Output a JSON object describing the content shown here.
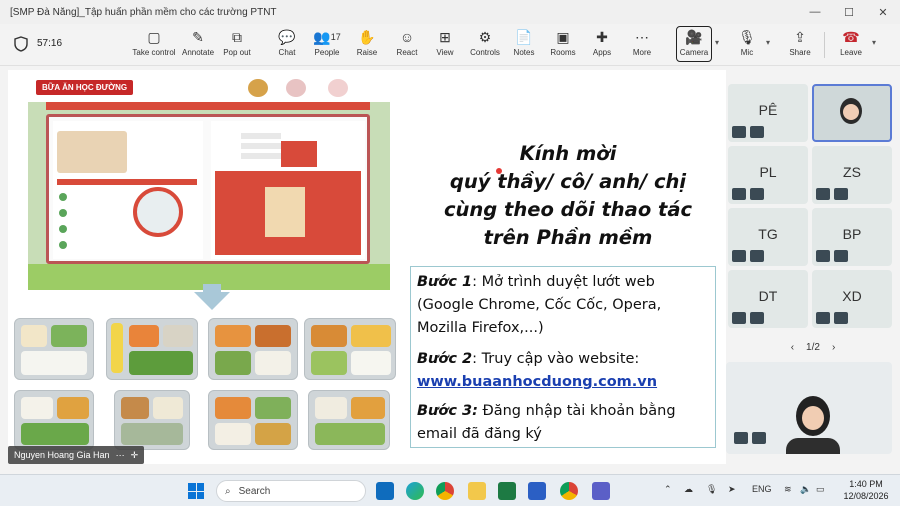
{
  "window": {
    "title": "[SMP Đà Nẵng]_Tập huấn phần mềm cho các trường PTNT",
    "min": "—",
    "max": "☐",
    "close": "✕"
  },
  "toolbar": {
    "timer": "57:16",
    "buttons": [
      {
        "id": "take-control",
        "label": "Take control",
        "icon": "▢"
      },
      {
        "id": "annotate",
        "label": "Annotate",
        "icon": "✎"
      },
      {
        "id": "pop-out",
        "label": "Pop out",
        "icon": "⧉"
      },
      {
        "id": "chat",
        "label": "Chat",
        "icon": "💬"
      },
      {
        "id": "people",
        "label": "People",
        "icon": "👥",
        "count": "17"
      },
      {
        "id": "raise",
        "label": "Raise",
        "icon": "✋"
      },
      {
        "id": "react",
        "label": "React",
        "icon": "☺"
      },
      {
        "id": "view",
        "label": "View",
        "icon": "⊞"
      },
      {
        "id": "controls",
        "label": "Controls",
        "icon": "⚙"
      },
      {
        "id": "notes",
        "label": "Notes",
        "icon": "📄"
      },
      {
        "id": "rooms",
        "label": "Rooms",
        "icon": "▣"
      },
      {
        "id": "apps",
        "label": "Apps",
        "icon": "✚"
      },
      {
        "id": "more",
        "label": "More",
        "icon": "⋯"
      }
    ],
    "camera": {
      "label": "Camera",
      "icon": "🎥"
    },
    "mic": {
      "label": "Mic",
      "icon": "🎙"
    },
    "share": {
      "label": "Share",
      "icon": "⇪"
    },
    "leave": {
      "label": "Leave",
      "icon": "☎"
    }
  },
  "slide": {
    "website_logo": "BỮA ĂN HỌC ĐƯỜNG",
    "invite_lines": [
      "Kính mời",
      "quý thầy/ cô/ anh/ chị",
      "cùng theo dõi thao tác",
      "trên Phần mềm"
    ],
    "step1_label": "Bước 1",
    "step1_text": ": Mở trình duyệt lướt web (Google Chrome, Cốc Cốc, Opera, Mozilla Firefox,...)",
    "step2_label": "Bước 2",
    "step2_text": ": Truy cập vào website:",
    "step2_link": "www.buaanhocduong.com.vn",
    "step3_label": "Bước 3:",
    "step3_text": " Đăng nhập tài khoản bằng email đã đăng ký"
  },
  "presenter": {
    "name": "Nguyen Hoang Gia Han",
    "more": "⋯",
    "pin": "✛"
  },
  "participants": {
    "tiles": [
      {
        "initials": "PÊ"
      },
      {
        "initials": ""
      },
      {
        "initials": "PL"
      },
      {
        "initials": "ZS"
      },
      {
        "initials": "TG"
      },
      {
        "initials": "BP"
      },
      {
        "initials": "DT"
      },
      {
        "initials": "XD"
      }
    ],
    "page": "1/2",
    "prev": "‹",
    "next": "›"
  },
  "taskbar": {
    "search_placeholder": "Search",
    "language": "ENG",
    "time": "1:40 PM",
    "date": "12/08/2026",
    "colors": {
      "accent": "#0a74d6"
    }
  }
}
